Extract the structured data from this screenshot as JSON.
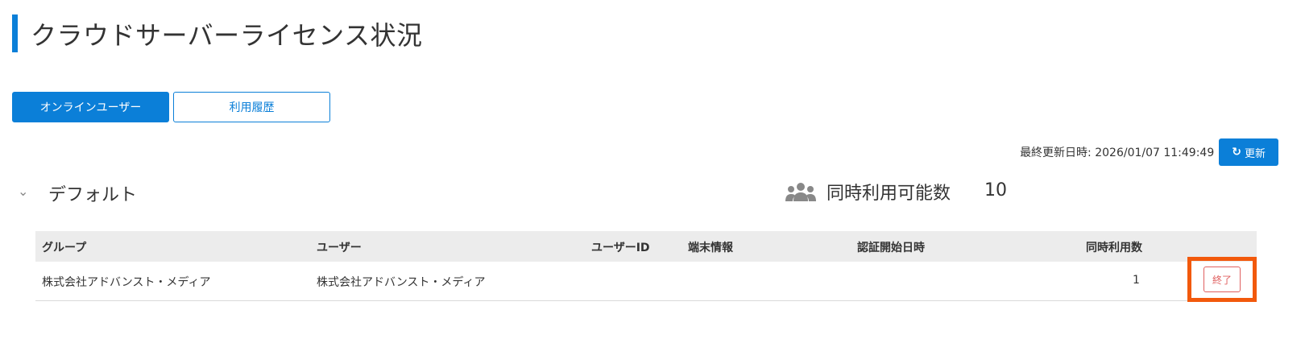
{
  "page": {
    "title": "クラウドサーバーライセンス状況"
  },
  "tabs": [
    {
      "label": "オンラインユーザー",
      "active": true
    },
    {
      "label": "利用履歴",
      "active": false
    }
  ],
  "toolbar": {
    "last_updated": "最終更新日時: 2026/01/07 11:49:49",
    "refresh_label": "更新"
  },
  "group": {
    "name": "デフォルト",
    "concurrent_label": "同時利用可能数",
    "concurrent_value": "10"
  },
  "table": {
    "columns": [
      "グループ",
      "ユーザー",
      "ユーザーID",
      "端末情報",
      "認証開始日時",
      "同時利用数"
    ],
    "rows": [
      {
        "group": "株式会社アドバンスト・メディア",
        "user": "株式会社アドバンスト・メディア",
        "user_id": "",
        "device": "",
        "auth_start": "",
        "count": "1",
        "action_label": "終了"
      }
    ]
  },
  "colors": {
    "primary": "#0b7fd8",
    "highlight": "#f2590c",
    "danger": "#e06060"
  },
  "icons": {
    "refresh": "refresh-icon",
    "users": "users-icon",
    "collapse": "chevron-down-icon"
  }
}
